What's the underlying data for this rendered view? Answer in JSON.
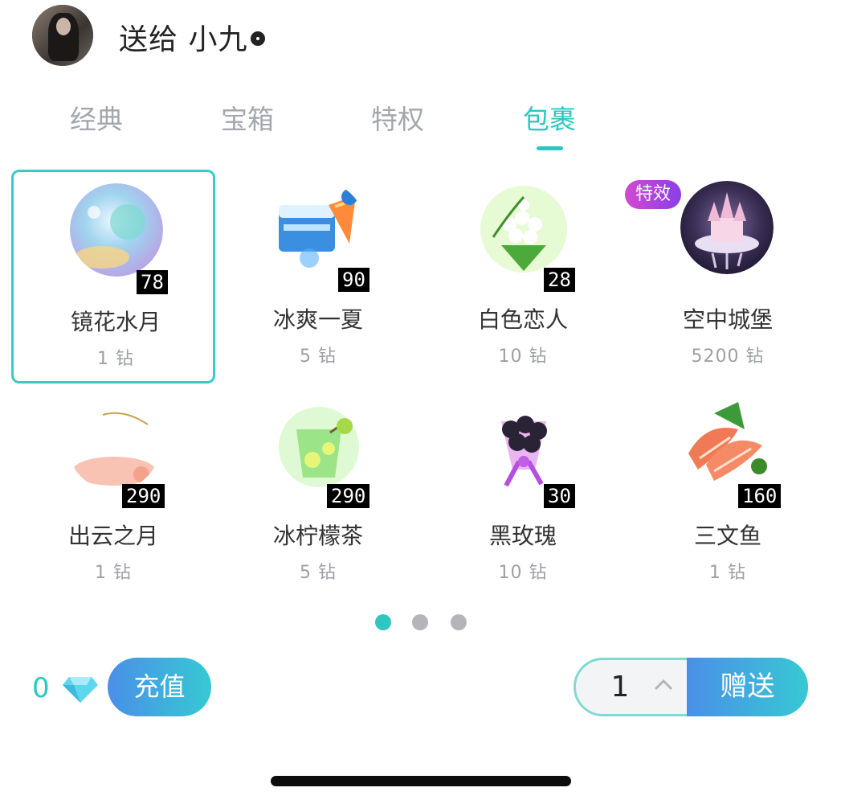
{
  "header": {
    "send_to_prefix": "送给",
    "recipient": "小九"
  },
  "tabs": [
    {
      "label": "经典",
      "active": false
    },
    {
      "label": "宝箱",
      "active": false
    },
    {
      "label": "特权",
      "active": false
    },
    {
      "label": "包裹",
      "active": true
    }
  ],
  "gifts": [
    {
      "name": "镜花水月",
      "count": "78",
      "price": "1 钻",
      "selected": true,
      "icon": "moon-orb-icon"
    },
    {
      "name": "冰爽一夏",
      "count": "90",
      "price": "5 钻",
      "selected": false,
      "icon": "ice-box-icon"
    },
    {
      "name": "白色恋人",
      "count": "28",
      "price": "10 钻",
      "selected": false,
      "icon": "lily-bouquet-icon"
    },
    {
      "name": "空中城堡",
      "count": "",
      "price": "5200 钻",
      "selected": false,
      "icon": "sky-castle-icon",
      "badge": "特效"
    },
    {
      "name": "出云之月",
      "count": "290",
      "price": "1 钻",
      "selected": false,
      "icon": "crescent-moon-icon"
    },
    {
      "name": "冰柠檬茶",
      "count": "290",
      "price": "5 钻",
      "selected": false,
      "icon": "lemon-tea-icon"
    },
    {
      "name": "黑玫瑰",
      "count": "30",
      "price": "10 钻",
      "selected": false,
      "icon": "black-rose-icon"
    },
    {
      "name": "三文鱼",
      "count": "160",
      "price": "1 钻",
      "selected": false,
      "icon": "salmon-icon"
    }
  ],
  "pager": {
    "pages": 3,
    "current": 1
  },
  "bottom": {
    "balance": "0",
    "recharge_label": "充值",
    "quantity": "1",
    "send_label": "赠送"
  },
  "colors": {
    "accent": "#2ec6c0",
    "gradient_start": "#4a8fe8",
    "gradient_end": "#36c9d3",
    "badge": "#b044dc"
  }
}
